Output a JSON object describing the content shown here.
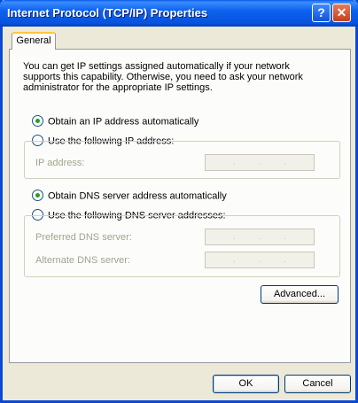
{
  "window": {
    "title": "Internet Protocol (TCP/IP) Properties",
    "help_glyph": "?",
    "close_glyph": "✕"
  },
  "tabs": [
    {
      "label": "General",
      "active": true
    }
  ],
  "general": {
    "info_text": "You can get IP settings assigned automatically if your network supports this capability. Otherwise, you need to ask your network administrator for the appropriate IP settings.",
    "ip_mode": {
      "auto_label": "Obtain an IP address automatically",
      "manual_label": "Use the following IP address:",
      "selected": "auto"
    },
    "ip_fields": [
      {
        "label": "IP address:",
        "value": ".   .   ."
      }
    ],
    "dns_mode": {
      "auto_label": "Obtain DNS server address automatically",
      "manual_label": "Use the following DNS server addresses:",
      "selected": "auto"
    },
    "dns_fields": [
      {
        "label": "Preferred DNS server:",
        "value": ".   .   ."
      },
      {
        "label": "Alternate DNS server:",
        "value": ".   .   ."
      }
    ],
    "advanced_label": "Advanced..."
  },
  "footer": {
    "ok_label": "OK",
    "cancel_label": "Cancel"
  },
  "colors": {
    "title_bar": "#0653de",
    "selected_radio": "#21a121",
    "tab_highlight": "#ffc83d"
  }
}
